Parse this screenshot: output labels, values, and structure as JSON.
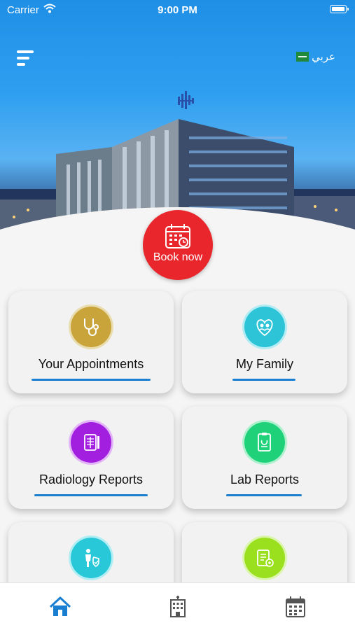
{
  "status_bar": {
    "carrier": "Carrier",
    "time": "9:00 PM"
  },
  "header": {
    "language_label": "عربي"
  },
  "book_now": {
    "label": "Book now"
  },
  "cards": [
    {
      "label": "Your Appointments",
      "color": "#c9a43a",
      "icon": "stethoscope-icon"
    },
    {
      "label": "My Family",
      "color": "#2ec4d8",
      "icon": "family-icon"
    },
    {
      "label": "Radiology Reports",
      "color": "#a21fe0",
      "icon": "xray-icon"
    },
    {
      "label": "Lab Reports",
      "color": "#1fd27a",
      "icon": "lab-report-icon"
    },
    {
      "label": "",
      "color": "#28c8d8",
      "icon": "insurance-icon"
    },
    {
      "label": "",
      "color": "#9be01f",
      "icon": "prescription-icon"
    }
  ],
  "tabs": [
    {
      "name": "home-icon",
      "active_color": "#1a7fd1"
    },
    {
      "name": "hospital-icon",
      "color": "#555555"
    },
    {
      "name": "calendar-icon",
      "color": "#555555"
    }
  ]
}
